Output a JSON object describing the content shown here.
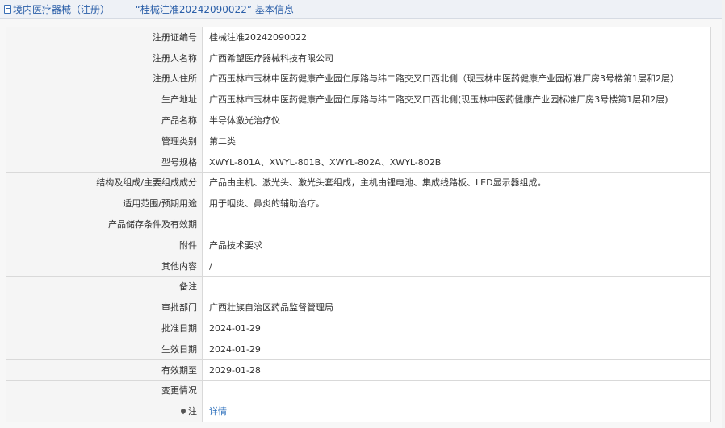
{
  "header": {
    "title": "境内医疗器械（注册） —— “桂械注准20242090022” 基本信息"
  },
  "rows": [
    {
      "label": "注册证编号",
      "value": "桂械注准20242090022"
    },
    {
      "label": "注册人名称",
      "value": "广西希望医疗器械科技有限公司"
    },
    {
      "label": "注册人住所",
      "value": "广西玉林市玉林中医药健康产业园仁厚路与纬二路交叉口西北侧（现玉林中医药健康产业园标准厂房3号楼第1层和2层）"
    },
    {
      "label": "生产地址",
      "value": "广西玉林市玉林中医药健康产业园仁厚路与纬二路交叉口西北侧(现玉林中医药健康产业园标准厂房3号楼第1层和2层)"
    },
    {
      "label": "产品名称",
      "value": "半导体激光治疗仪"
    },
    {
      "label": "管理类别",
      "value": "第二类"
    },
    {
      "label": "型号规格",
      "value": "XWYL-801A、XWYL-801B、XWYL-802A、XWYL-802B"
    },
    {
      "label": "结构及组成/主要组成成分",
      "value": "产品由主机、激光头、激光头套组成，主机由锂电池、集成线路板、LED显示器组成。"
    },
    {
      "label": "适用范围/预期用途",
      "value": "用于咽炎、鼻炎的辅助治疗。"
    },
    {
      "label": "产品储存条件及有效期",
      "value": ""
    },
    {
      "label": "附件",
      "value": "产品技术要求"
    },
    {
      "label": "其他内容",
      "value": "/"
    },
    {
      "label": "备注",
      "value": ""
    },
    {
      "label": "审批部门",
      "value": "广西壮族自治区药品监督管理局"
    },
    {
      "label": "批准日期",
      "value": "2024-01-29"
    },
    {
      "label": "生效日期",
      "value": "2024-01-29"
    },
    {
      "label": "有效期至",
      "value": "2029-01-28"
    },
    {
      "label": "变更情况",
      "value": ""
    }
  ],
  "note": {
    "label": "注",
    "link": "详情"
  }
}
